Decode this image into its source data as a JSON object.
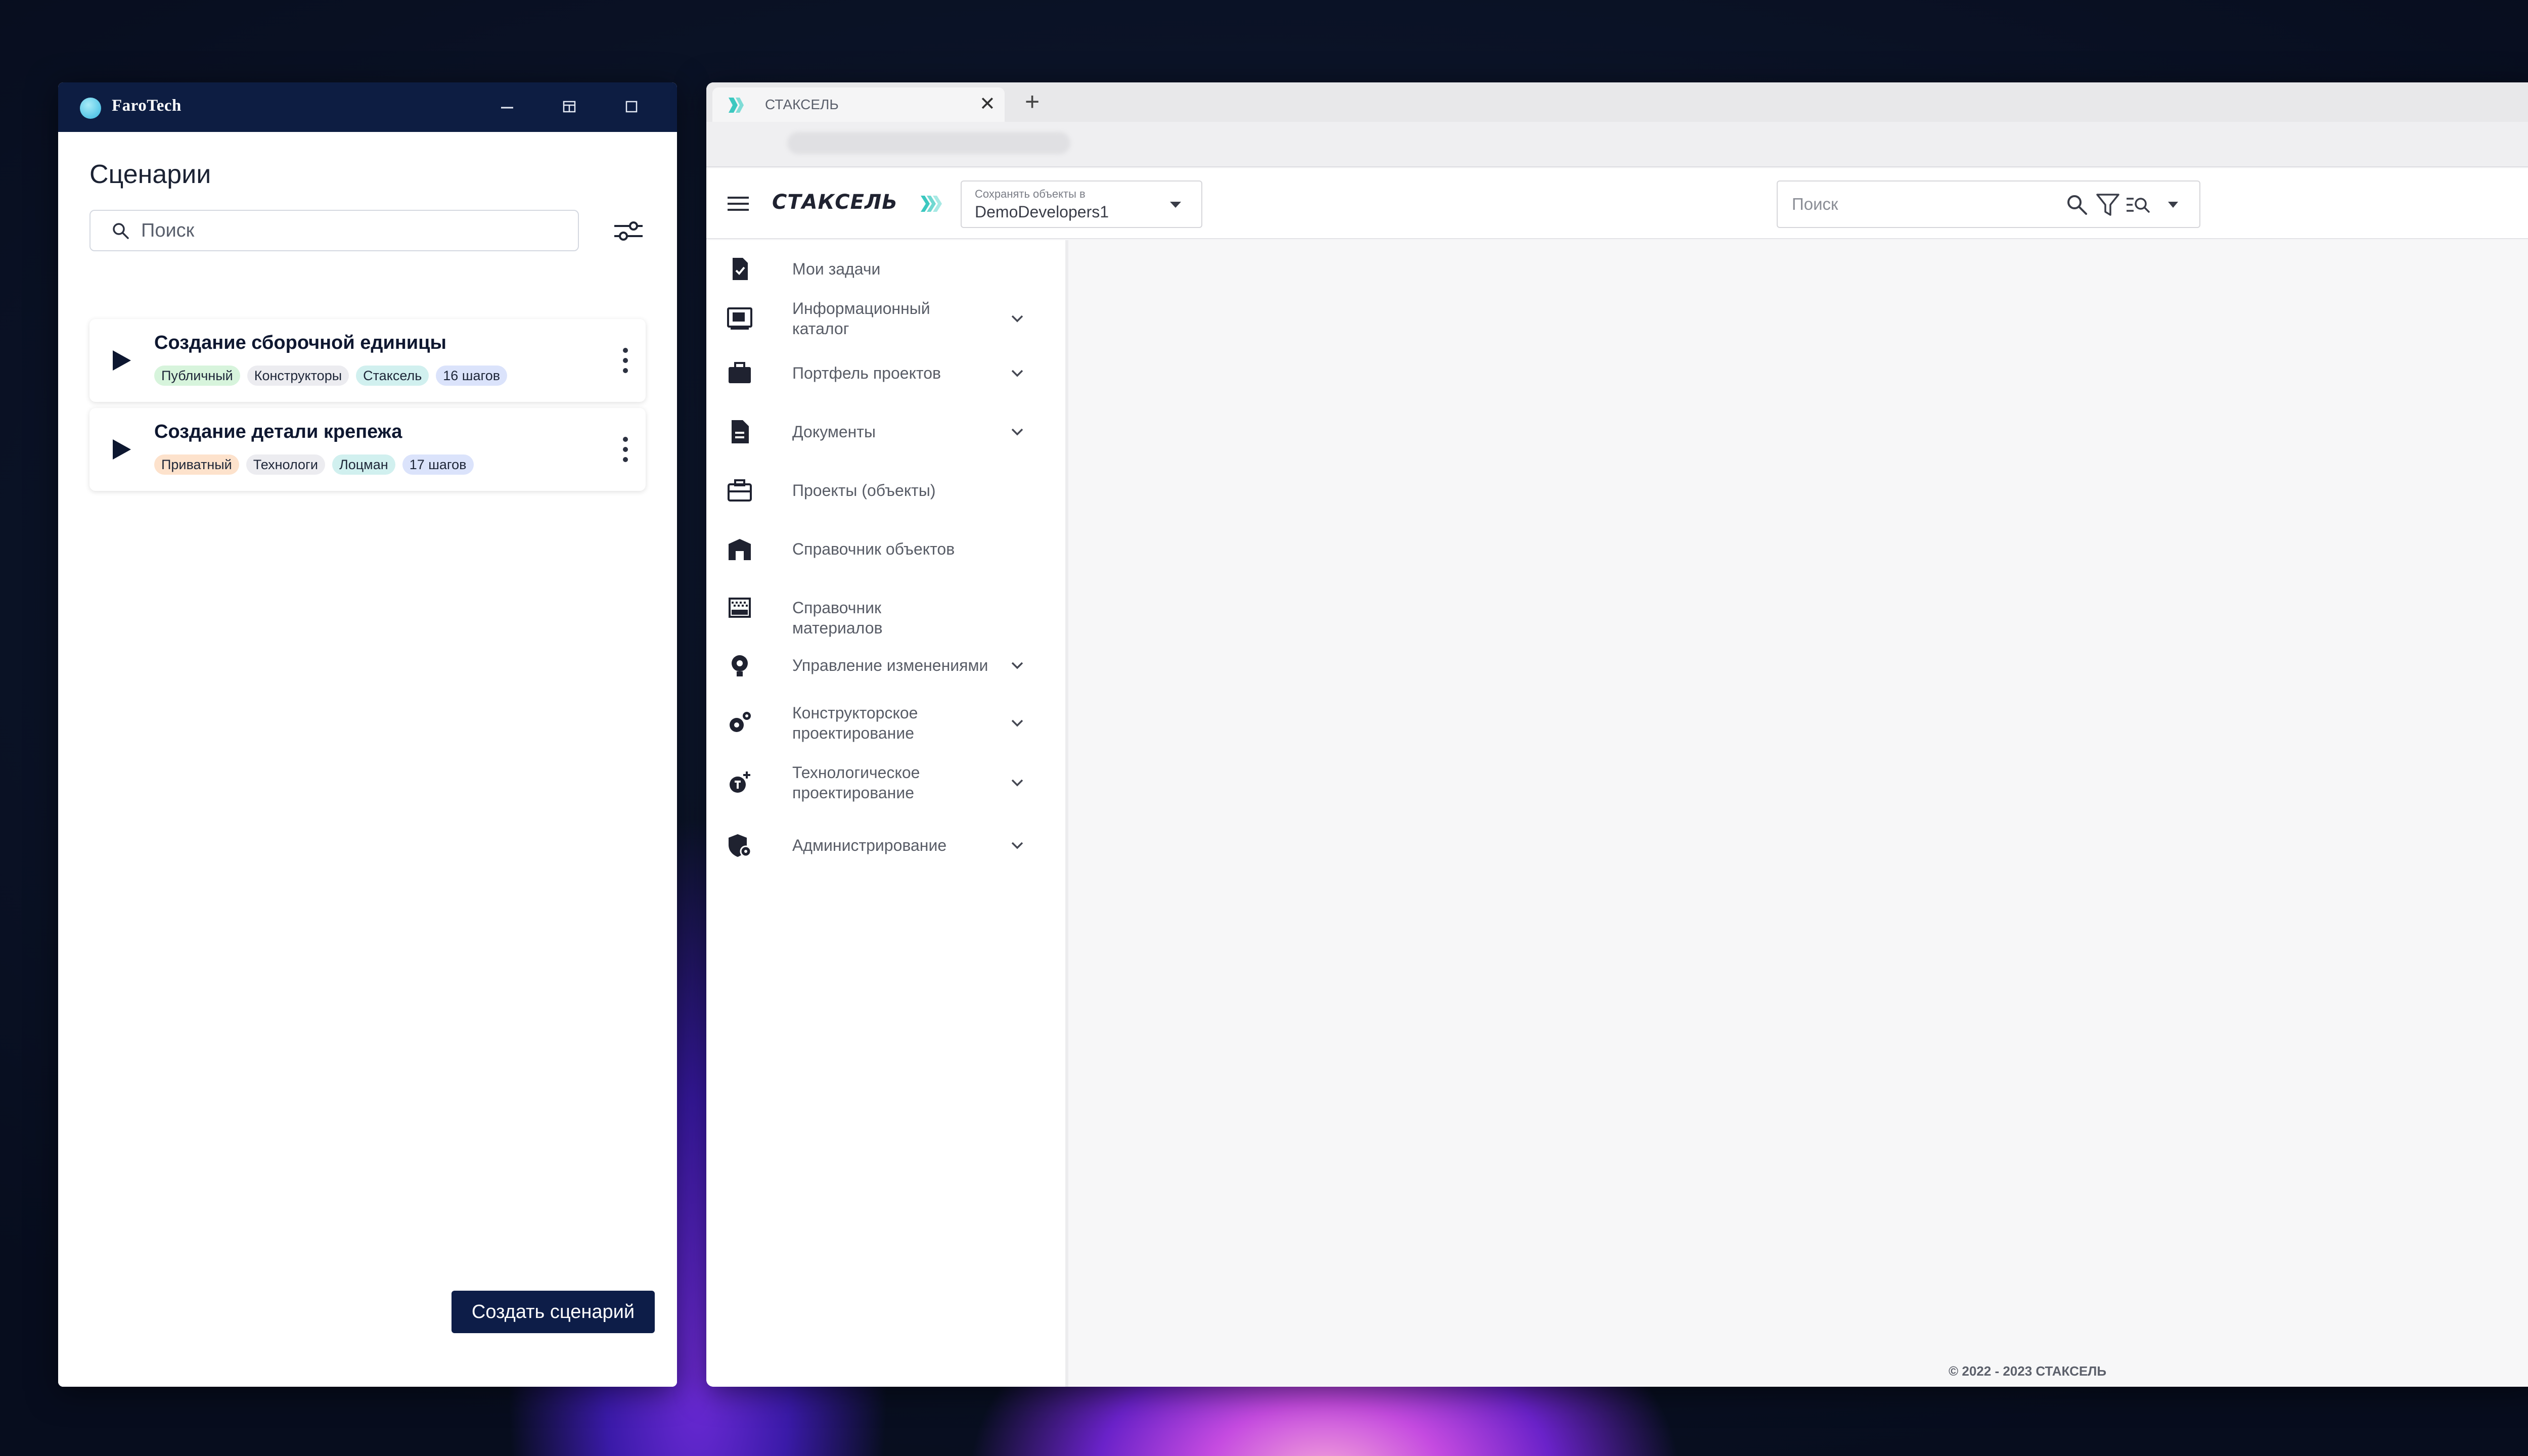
{
  "faro": {
    "app_title": "FaroTech",
    "controls": {
      "minimize": "—",
      "snap": "⊟",
      "maximize": "☐",
      "close": "✕"
    },
    "heading": "Сценарии",
    "search": {
      "placeholder": "Поиск",
      "value": ""
    },
    "scenarios": [
      {
        "title": "Создание сборочной единицы",
        "tags": [
          "Публичный",
          "Конструкторы",
          "Стаксель",
          "16 шагов"
        ]
      },
      {
        "title": "Создание детали крепежа",
        "tags": [
          "Приватный",
          "Технологи",
          "Лоцман",
          "17 шагов"
        ]
      }
    ],
    "create_button": "Создать сценарий"
  },
  "browser": {
    "tab_title": "СТАКСЕЛЬ",
    "tab_close": "✕",
    "new_tab": "+"
  },
  "app": {
    "brand": "СТАКСЕЛЬ",
    "save_select": {
      "label": "Сохранять объекты в",
      "value": "DemoDevelopers1"
    },
    "search": {
      "placeholder": "Поиск",
      "value": ""
    },
    "nav": [
      {
        "label": "Мои задачи",
        "icon": "task-check-icon",
        "expandable": false
      },
      {
        "label": "Информационный каталог",
        "icon": "catalog-icon",
        "expandable": true
      },
      {
        "label": "Портфель проектов",
        "icon": "briefcase-icon",
        "expandable": true
      },
      {
        "label": "Документы",
        "icon": "document-icon",
        "expandable": true
      },
      {
        "label": "Проекты (объекты)",
        "icon": "toolcase-icon",
        "expandable": false
      },
      {
        "label": "Справочник объектов",
        "icon": "building-icon",
        "expandable": false
      },
      {
        "label": "Справочник материалов",
        "icon": "materials-icon",
        "expandable": false
      },
      {
        "label": "Управление изменениями",
        "icon": "change-icon",
        "expandable": true
      },
      {
        "label": "Конструкторское проектирование",
        "icon": "gears-icon",
        "expandable": true
      },
      {
        "label": "Технологическое проектирование",
        "icon": "tech-icon",
        "expandable": true
      },
      {
        "label": "Администрирование",
        "icon": "shield-gear-icon",
        "expandable": true
      }
    ],
    "footer": "© 2022 - 2023 СТАКСЕЛЬ"
  },
  "colors": {
    "faro_titlebar": "#0d1d42",
    "primary_button": "#0d1d48",
    "brand_accent": "#3cc8c0"
  }
}
